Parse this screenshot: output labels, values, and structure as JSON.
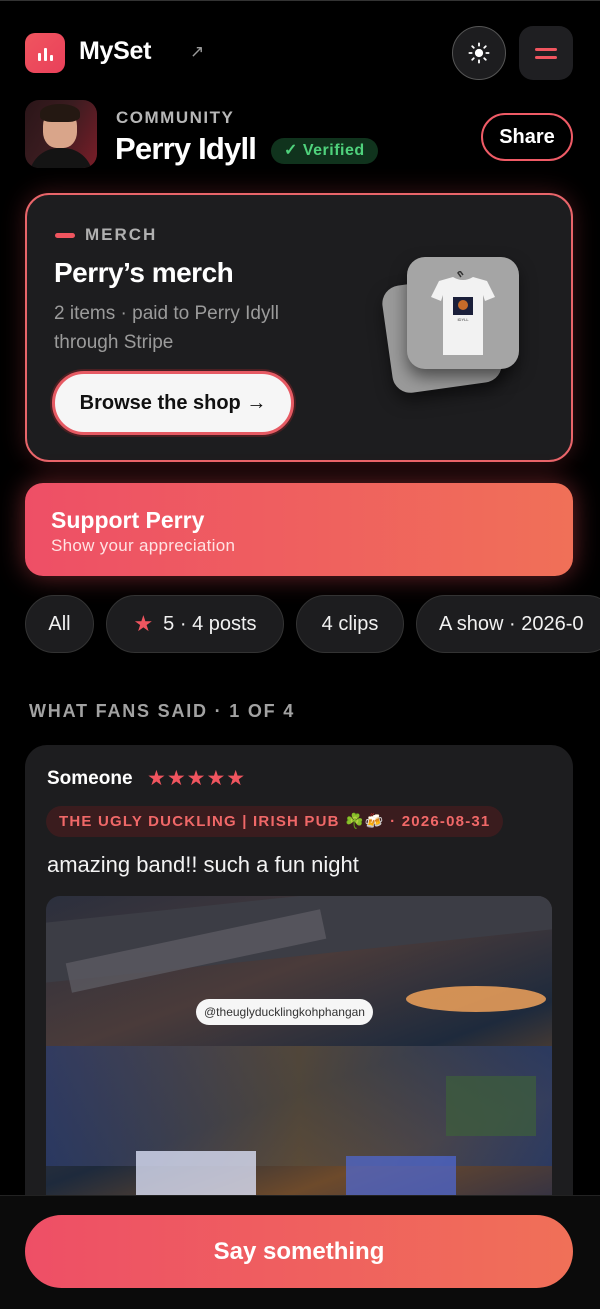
{
  "header": {
    "app_name": "MySet",
    "external_glyph": "↗",
    "icons": [
      "logo-bars-icon",
      "external-link-icon",
      "sun-icon",
      "menu-icon"
    ]
  },
  "profile": {
    "section_label": "COMMUNITY",
    "name": "Perry Idyll",
    "verified_label": "✓ Verified",
    "share_label": "Share"
  },
  "merch": {
    "tag": "MERCH",
    "title": "Perry’s merch",
    "subtitle": "2 items · paid to Perry Idyll through Stripe",
    "browse_label": "Browse the shop →",
    "shirt_print": "IDYLL"
  },
  "support": {
    "title": "Support Perry",
    "subtitle": "Show your appreciation"
  },
  "filters": [
    {
      "label": "All"
    },
    {
      "label": "5 · 4 posts",
      "icon": "★"
    },
    {
      "label": "4 clips"
    },
    {
      "label": "A show · 2026-0"
    }
  ],
  "fans": {
    "section_label": "WHAT FANS SAID · 1 OF 4",
    "review": {
      "author": "Someone",
      "stars": "★★★★★",
      "venue": "THE UGLY DUCKLING | IRISH PUB ☘️🍻 · 2026-08-31",
      "text": "amazing band!! such a fun night",
      "photo_tag": "@theuglyducklingkohphangan"
    }
  },
  "composer": {
    "cta_label": "Say something"
  },
  "colors": {
    "accent": "#f0555f",
    "accent_gradient_end": "#f07058",
    "background": "#000000",
    "card": "#1d1d1f",
    "verified": "#4fd27c"
  }
}
